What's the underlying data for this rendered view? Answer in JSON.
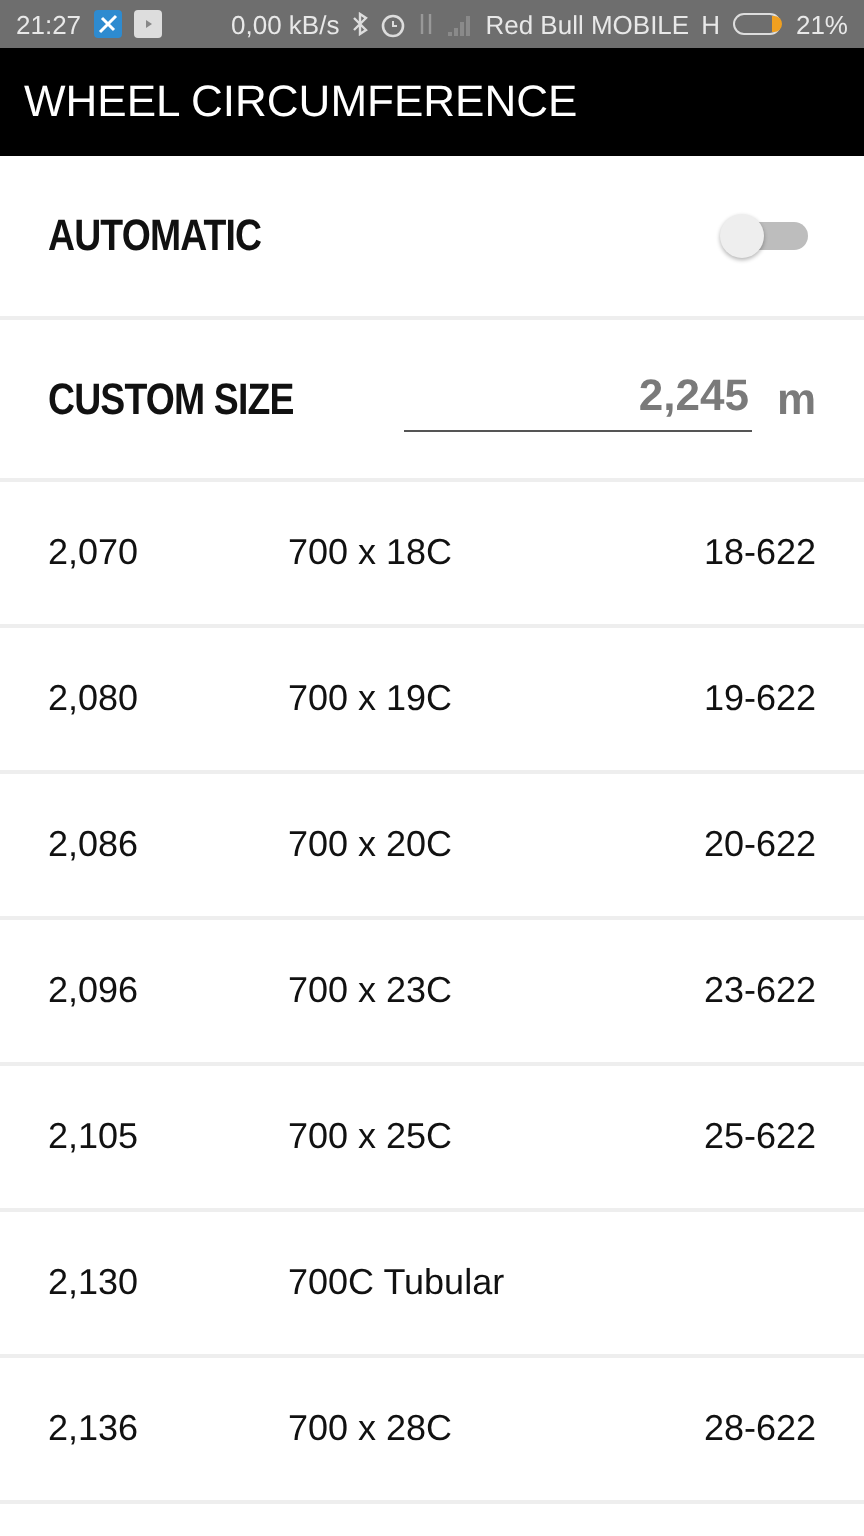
{
  "status_bar": {
    "time": "21:27",
    "speed": "0,00 kB/s",
    "carrier": "Red Bull MOBILE",
    "network": "H",
    "battery": "21%"
  },
  "app_bar": {
    "title": "WHEEL CIRCUMFERENCE"
  },
  "automatic": {
    "label": "AUTOMATIC",
    "on": false
  },
  "custom_size": {
    "label": "CUSTOM SIZE",
    "value": "2,245",
    "unit": "m"
  },
  "sizes": [
    {
      "circumference": "2,070",
      "tire": "700 x 18C",
      "etrto": "18-622"
    },
    {
      "circumference": "2,080",
      "tire": "700 x 19C",
      "etrto": "19-622"
    },
    {
      "circumference": "2,086",
      "tire": "700 x 20C",
      "etrto": "20-622"
    },
    {
      "circumference": "2,096",
      "tire": "700 x 23C",
      "etrto": "23-622"
    },
    {
      "circumference": "2,105",
      "tire": "700 x 25C",
      "etrto": "25-622"
    },
    {
      "circumference": "2,130",
      "tire": "700C Tubular"
    },
    {
      "circumference": "2,136",
      "tire": "700 x 28C",
      "etrto": "28-622"
    }
  ]
}
